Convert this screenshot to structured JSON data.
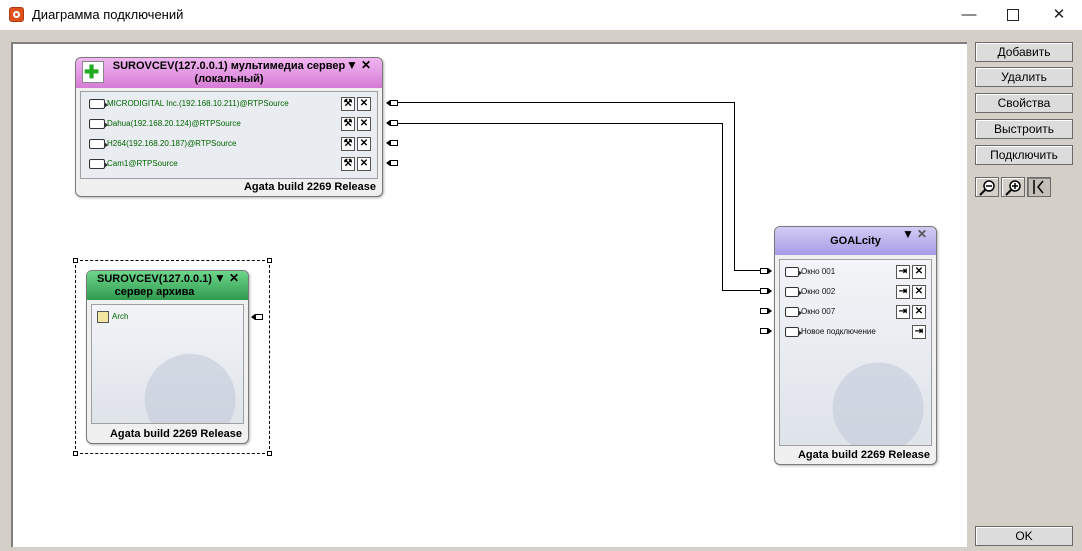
{
  "window": {
    "title": "Диаграмма подключений",
    "minimize_glyph": "—",
    "close_glyph": "✕"
  },
  "toolbar": {
    "buttons": [
      {
        "label": "Добавить"
      },
      {
        "label": "Удалить"
      },
      {
        "label": "Свойства"
      },
      {
        "label": "Выстроить"
      },
      {
        "label": "Подключить"
      }
    ],
    "zoom": [
      {
        "icon": "zoom-out-icon"
      },
      {
        "icon": "zoom-in-icon"
      },
      {
        "icon": "fit-icon"
      }
    ],
    "ok_label": "OK"
  },
  "media_server": {
    "title_line1": "SUROVCEV(127.0.0.1) мультимедиа сервер",
    "title_line2": "(локальный)",
    "header_color": "#d67bd6",
    "sources": [
      {
        "label": "MICRODIGITAL Inc.(192.168.10.211)@RTPSource"
      },
      {
        "label": "Dahua(192.168.20.124)@RTPSource"
      },
      {
        "label": "H264(192.168.20.187)@RTPSource"
      },
      {
        "label": "Cam1@RTPSource"
      }
    ],
    "footer": "Agata build 2269 Release"
  },
  "archive_server": {
    "title_line1": "SUROVCEV(127.0.0.1)",
    "title_line2": "сервер архива",
    "header_color": "#3aa55a",
    "items": [
      {
        "label": "Arch"
      }
    ],
    "footer": "Agata build 2269 Release"
  },
  "goalcity": {
    "title": "GOALcity",
    "header_color": "#a79be6",
    "windows": [
      {
        "label": "Окно 001"
      },
      {
        "label": "Окно 002"
      },
      {
        "label": "Окно 007"
      },
      {
        "label": "Новое подключение"
      }
    ],
    "footer": "Agata build 2269 Release"
  },
  "glyphs": {
    "dropdown": "▼",
    "close": "✕",
    "plus": "✚",
    "wrench": "🔧",
    "exit": "⇥"
  }
}
